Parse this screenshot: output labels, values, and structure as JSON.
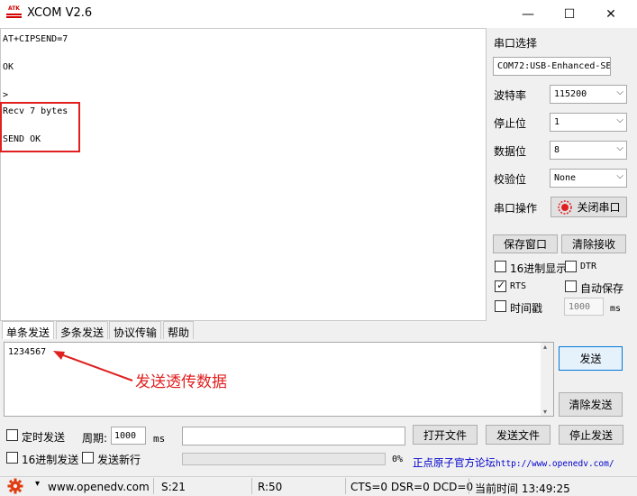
{
  "window": {
    "title": "XCOM V2.6",
    "logo_text": "ATK",
    "min_symbol": "—",
    "max_symbol": "☐",
    "close_symbol": "✕"
  },
  "receive": {
    "lines": [
      "AT+CIPSEND=7",
      "OK",
      ">",
      "Recv 7 bytes",
      "SEND OK"
    ]
  },
  "serial": {
    "section_title": "串口选择",
    "port_value": "COM72:USB-Enhanced-SE",
    "baud_label": "波特率",
    "baud_value": "115200",
    "stopbits_label": "停止位",
    "stopbits_value": "1",
    "databits_label": "数据位",
    "databits_value": "8",
    "parity_label": "校验位",
    "parity_value": "None",
    "operation_label": "串口操作",
    "close_port_label": "关闭串口",
    "save_window_label": "保存窗口",
    "clear_receive_label": "清除接收",
    "hex_display_label": "16进制显示",
    "dtr_label": "DTR",
    "rts_label": "RTS",
    "auto_save_label": "自动保存",
    "timestamp_label": "时间戳",
    "timestamp_value": "1000",
    "timestamp_unit": "ms"
  },
  "tabs": [
    "单条发送",
    "多条发送",
    "协议传输",
    "帮助"
  ],
  "send": {
    "text": "1234567",
    "annotation": "发送透传数据",
    "send_label": "发送",
    "clear_send_label": "清除发送",
    "timed_send_label": "定时发送",
    "period_label": "周期:",
    "period_value": "1000",
    "period_unit": "ms",
    "open_file_label": "打开文件",
    "send_file_label": "发送文件",
    "stop_send_label": "停止发送",
    "hex_send_label": "16进制发送",
    "newline_label": "发送新行",
    "progress_text": "0%",
    "progress_value": 0,
    "forum_label": "正点原子官方论坛",
    "forum_url": "http://www.openedv.com/"
  },
  "status": {
    "website": "www.openedv.com",
    "sent": "S:21",
    "received": "R:50",
    "lines": "CTS=0 DSR=0 DCD=0",
    "time": "当前时间 13:49:25"
  },
  "colors": {
    "accent": "#0078d7",
    "annotation": "#e02020",
    "gear": "#e03a10"
  }
}
